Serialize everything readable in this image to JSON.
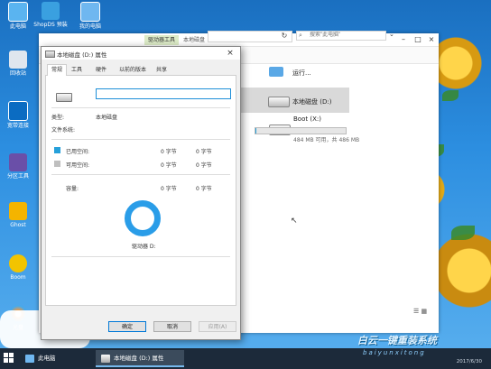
{
  "desktop": {
    "icons": [
      {
        "label": "此电脑"
      },
      {
        "label": "回收站"
      },
      {
        "label": "宽带连接"
      },
      {
        "label": "分区工具"
      },
      {
        "label": "Ghost"
      },
      {
        "label": "Boom"
      },
      {
        "label": "光盘"
      }
    ],
    "top_icons": [
      {
        "label": "ShopDS 预装"
      },
      {
        "label": "我的电脑"
      }
    ]
  },
  "explorer": {
    "tab_manage": "驱动器工具",
    "tab_title": "本地磁盘",
    "search_placeholder": "搜索\"此电脑\"",
    "items": {
      "run": "运行...",
      "drive_d": "本地磁盘 (D:)",
      "boot": "Boot (X:)",
      "boot_space": "484 MB 可用，共 486 MB"
    },
    "boot_used_fraction": 0.01
  },
  "dialog": {
    "title": "本地磁盘 (D:) 属性",
    "tabs": [
      "常规",
      "工具",
      "硬件",
      "以前的版本",
      "共享"
    ],
    "name_value": "",
    "type_label": "类型:",
    "type_value": "本地磁盘",
    "fs_label": "文件系统:",
    "used_label": "已用空间:",
    "used_bytes": "0 字节",
    "used_size": "0 字节",
    "free_label": "可用空间:",
    "free_bytes": "0 字节",
    "free_size": "0 字节",
    "capacity_label": "容量:",
    "capacity_bytes": "0 字节",
    "capacity_size": "0 字节",
    "drive_label": "驱动器 D:",
    "buttons": {
      "ok": "确定",
      "cancel": "取消",
      "apply": "应用(A)"
    },
    "colors": {
      "used": "#26a0da",
      "free": "#bfbfbf"
    }
  },
  "taskbar": {
    "items": [
      {
        "label": "此电脑"
      },
      {
        "label": "本地磁盘 (D:) 属性"
      }
    ],
    "date": "2017/6/30"
  },
  "watermark": {
    "text": "白云一键重装系统",
    "sub": "baiyunxitong"
  }
}
